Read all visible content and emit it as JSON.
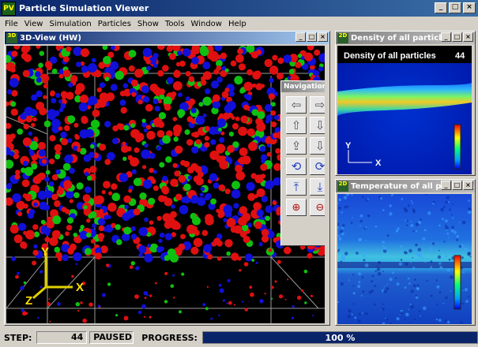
{
  "app": {
    "title": "Particle Simulation Viewer"
  },
  "menu": [
    "File",
    "View",
    "Simulation",
    "Particles",
    "Show",
    "Tools",
    "Window",
    "Help"
  ],
  "view3d": {
    "title": "3D-View (HW)",
    "axis_labels": {
      "x": "X",
      "y": "Y",
      "z": "Z"
    }
  },
  "navigation": {
    "title": "Navigation",
    "buttons": [
      "arrow-left-icon",
      "arrow-right-icon",
      "arrow-up-icon",
      "arrow-down-icon",
      "move-up-icon",
      "move-down-icon",
      "rotate-left-icon",
      "rotate-right-icon",
      "rotate-up-icon",
      "rotate-down-icon",
      "zoom-in-icon",
      "zoom-out-icon"
    ]
  },
  "density": {
    "title": "Density of all particles",
    "label": "Density of all particles",
    "value": "44",
    "axis_y": "Y",
    "axis_x": "X"
  },
  "temperature": {
    "title": "Temperature of all particles"
  },
  "status": {
    "step_label": "STEP:",
    "step_value": "44",
    "state": "PAUSED",
    "progress_label": "PROGRESS:",
    "progress_value": "100 %",
    "progress_fraction": 1.0
  },
  "colors": {
    "accent": "#0a246a",
    "particle_red": "#e01010",
    "particle_blue": "#1010d8",
    "particle_green": "#10c010"
  }
}
